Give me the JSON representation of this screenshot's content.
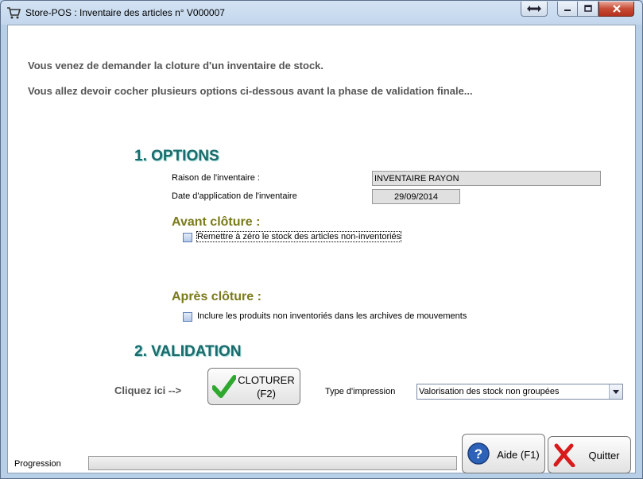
{
  "window": {
    "title": "Store-POS : Inventaire des articles n° V000007",
    "app_icon": "shopping-cart-icon",
    "buttons": {
      "extra": "swap-arrows-icon",
      "minimize": "minimize-icon",
      "maximize": "maximize-icon",
      "close": "close-icon"
    },
    "close_color": "#c74b35"
  },
  "intro": {
    "line1": "Vous venez de demander la cloture d'un inventaire de stock.",
    "line2": "Vous allez devoir cocher plusieurs options ci-dessous avant la phase de validation finale..."
  },
  "options": {
    "heading": "1. OPTIONS",
    "reason_label": "Raison de l'inventaire :",
    "reason_value": "INVENTAIRE RAYON",
    "date_label": "Date d'application de l'inventaire",
    "date_value": "29/09/2014",
    "before": {
      "heading": "Avant clôture :",
      "checkbox_label": "Remettre à zéro le stock des articles non-inventoriés",
      "checked": false
    },
    "after": {
      "heading": "Après clôture :",
      "checkbox_label": "Inclure les produits non inventoriés dans les archives de mouvements",
      "checked": false
    }
  },
  "validation": {
    "heading": "2. VALIDATION",
    "click_here": "Cliquez ici -->",
    "close_button_line1": "CLOTURER",
    "close_button_line2": "(F2)",
    "close_button_icon": "checkmark-icon",
    "print_type_label": "Type d'impression",
    "print_type_value": "Valorisation des stock non groupées"
  },
  "footer": {
    "progress_label": "Progression",
    "progress_value": 0,
    "help_button": "Aide (F1)",
    "help_icon": "help-question-icon",
    "quit_button": "Quitter",
    "quit_icon": "red-x-icon"
  },
  "colors": {
    "section_heading": "#1a6b6b",
    "sub_heading": "#7a7a1a",
    "check_green": "#2fa82f",
    "quit_red": "#d81a1a",
    "help_blue": "#2e62b8"
  }
}
